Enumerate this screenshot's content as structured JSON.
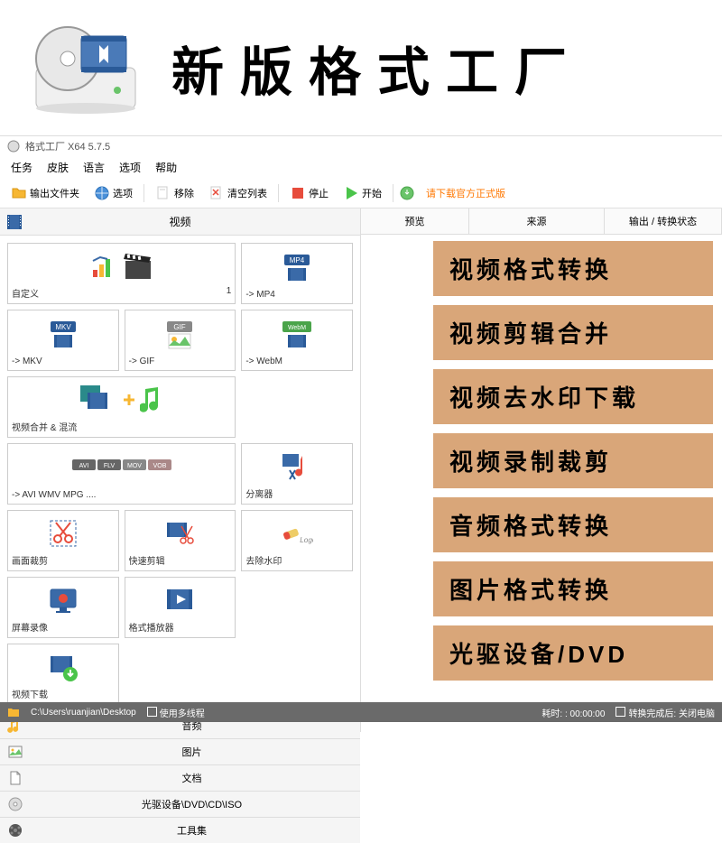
{
  "banner": {
    "title": "新版格式工厂"
  },
  "titleBar": {
    "text": "格式工厂 X64 5.7.5"
  },
  "menu": {
    "items": [
      "任务",
      "皮肤",
      "语言",
      "选项",
      "帮助"
    ]
  },
  "toolbar": {
    "outputFolder": "输出文件夹",
    "options": "选项",
    "remove": "移除",
    "clearList": "清空列表",
    "stop": "停止",
    "start": "开始",
    "downloadLink": "请下载官方正式版"
  },
  "category": {
    "video": "视频"
  },
  "formats": {
    "custom": {
      "label": "自定义",
      "count": "1"
    },
    "mp4": "-> MP4",
    "mkv": "-> MKV",
    "gif": "-> GIF",
    "webm": "-> WebM",
    "merge": "视频合并 & 混流",
    "aviWmv": "-> AVI WMV MPG ....",
    "splitter": "分离器",
    "crop": "画面裁剪",
    "quickEdit": "快速剪辑",
    "removeWatermark": "去除水印",
    "screenRecord": "屏幕录像",
    "player": "格式播放器",
    "download": "视频下载"
  },
  "collapsed": {
    "audio": "音频",
    "image": "图片",
    "document": "文档",
    "dvd": "光驱设备\\DVD\\CD\\ISO",
    "tools": "工具集"
  },
  "listHeader": {
    "preview": "预览",
    "source": "来源",
    "output": "输出 / 转换状态"
  },
  "features": [
    "视频格式转换",
    "视频剪辑合并",
    "视频去水印下载",
    "视频录制裁剪",
    "音频格式转换",
    "图片格式转换",
    "光驱设备/DVD"
  ],
  "statusBar": {
    "path": "C:\\Users\\ruanjian\\Desktop",
    "multithread": "使用多线程",
    "elapsed": "耗时: : 00:00:00",
    "afterDone": "转换完成后: 关闭电脑"
  },
  "badges": {
    "mp4": "MP4",
    "mkv": "MKV",
    "gif": "GIF",
    "webm": "WebM",
    "avi": "AVI",
    "flv": "FLV",
    "mov": "MOV",
    "vob": "VOB"
  }
}
